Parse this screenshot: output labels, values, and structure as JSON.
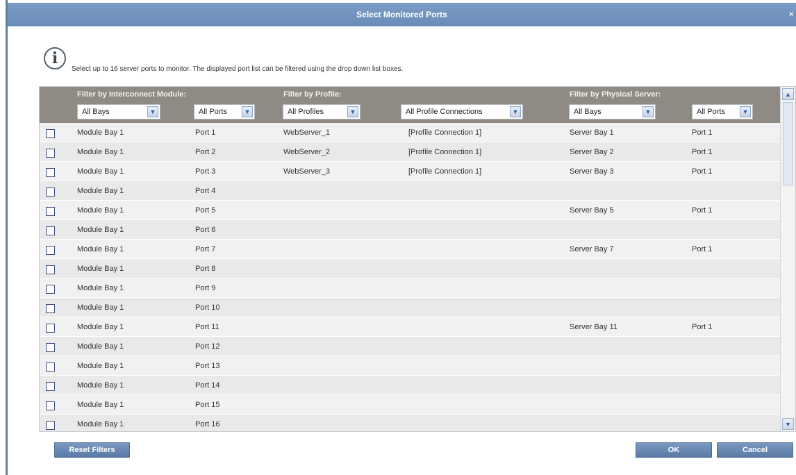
{
  "dialog": {
    "title": "Select Monitored Ports",
    "info_text": "Select up to 16 server ports to monitor. The displayed port list can be filtered using the drop down list boxes."
  },
  "filters": {
    "interconnect": {
      "label": "Filter by Interconnect Module:",
      "bay": "All Bays",
      "port": "All Ports"
    },
    "profile": {
      "label": "Filter by Profile:",
      "profiles": "All Profiles",
      "connections": "All Profile Connections"
    },
    "server": {
      "label": "Filter by Physical Server:",
      "bay": "All Bays",
      "port": "All Ports"
    }
  },
  "rows": [
    {
      "module": "Module Bay 1",
      "port": "Port 1",
      "profile": "WebServer_1",
      "connection": "[Profile Connection 1]",
      "server_bay": "Server Bay 1",
      "server_port": "Port 1"
    },
    {
      "module": "Module Bay 1",
      "port": "Port 2",
      "profile": "WebServer_2",
      "connection": "[Profile Connection 1]",
      "server_bay": "Server Bay 2",
      "server_port": "Port 1"
    },
    {
      "module": "Module Bay 1",
      "port": "Port 3",
      "profile": "WebServer_3",
      "connection": "[Profile Connection 1]",
      "server_bay": "Server Bay 3",
      "server_port": "Port 1"
    },
    {
      "module": "Module Bay 1",
      "port": "Port 4",
      "profile": "",
      "connection": "",
      "server_bay": "",
      "server_port": ""
    },
    {
      "module": "Module Bay 1",
      "port": "Port 5",
      "profile": "",
      "connection": "",
      "server_bay": "Server Bay 5",
      "server_port": "Port 1"
    },
    {
      "module": "Module Bay 1",
      "port": "Port 6",
      "profile": "",
      "connection": "",
      "server_bay": "",
      "server_port": ""
    },
    {
      "module": "Module Bay 1",
      "port": "Port 7",
      "profile": "",
      "connection": "",
      "server_bay": "Server Bay 7",
      "server_port": "Port 1"
    },
    {
      "module": "Module Bay 1",
      "port": "Port 8",
      "profile": "",
      "connection": "",
      "server_bay": "",
      "server_port": ""
    },
    {
      "module": "Module Bay 1",
      "port": "Port 9",
      "profile": "",
      "connection": "",
      "server_bay": "",
      "server_port": ""
    },
    {
      "module": "Module Bay 1",
      "port": "Port 10",
      "profile": "",
      "connection": "",
      "server_bay": "",
      "server_port": ""
    },
    {
      "module": "Module Bay 1",
      "port": "Port 11",
      "profile": "",
      "connection": "",
      "server_bay": "Server Bay 11",
      "server_port": "Port 1"
    },
    {
      "module": "Module Bay 1",
      "port": "Port 12",
      "profile": "",
      "connection": "",
      "server_bay": "",
      "server_port": ""
    },
    {
      "module": "Module Bay 1",
      "port": "Port 13",
      "profile": "",
      "connection": "",
      "server_bay": "",
      "server_port": ""
    },
    {
      "module": "Module Bay 1",
      "port": "Port 14",
      "profile": "",
      "connection": "",
      "server_bay": "",
      "server_port": ""
    },
    {
      "module": "Module Bay 1",
      "port": "Port 15",
      "profile": "",
      "connection": "",
      "server_bay": "",
      "server_port": ""
    },
    {
      "module": "Module Bay 1",
      "port": "Port 16",
      "profile": "",
      "connection": "",
      "server_bay": "",
      "server_port": ""
    }
  ],
  "buttons": {
    "reset": "Reset Filters",
    "ok": "OK",
    "cancel": "Cancel"
  },
  "colors": {
    "title_bar": "#6a8cb8",
    "header": "#8f8a84",
    "button": "#5a7aa6"
  }
}
